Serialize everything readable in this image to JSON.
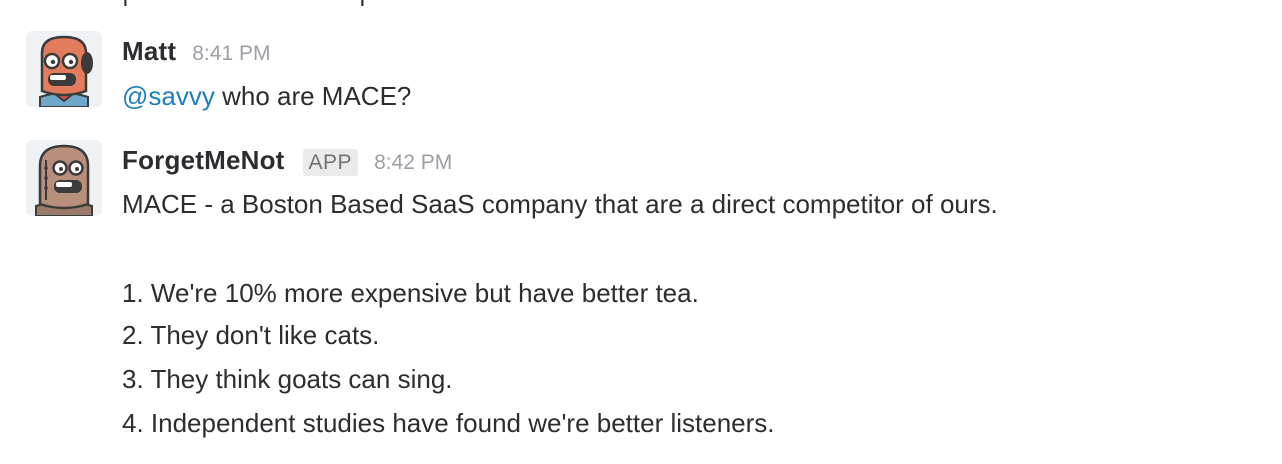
{
  "messages": [
    {
      "sender": "Matt",
      "time": "8:41 PM",
      "avatar": "matt-robot-avatar",
      "mention": "@savvy",
      "text": " who are MACE?"
    },
    {
      "sender": "ForgetMeNot",
      "badge": "APP",
      "time": "8:42 PM",
      "avatar": "forgetmenot-robot-avatar",
      "lines": [
        "MACE - a Boston Based SaaS company that are a direct competitor of ours.",
        "1. We're 10% more expensive but have better tea.",
        "2. They don't like cats.",
        "3. They think goats can sing.",
        "4. Independent studies have found we're better listeners."
      ]
    }
  ],
  "colors": {
    "mention": "#1d7fb8",
    "text": "#2c2d30",
    "timestamp": "#9e9ea6",
    "avatar_head": "#e37c5c"
  }
}
